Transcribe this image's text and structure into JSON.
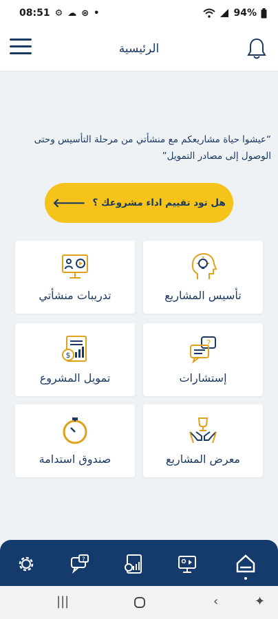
{
  "status_bar": {
    "time": "08:51",
    "battery": "94%"
  },
  "header": {
    "title": "الرئيسية"
  },
  "tagline": "“عيشوا حياة مشاريعكم مع منشأتي من مرحلة التأسيس وحتى الوصول إلى مصادر التمويل”",
  "cta": {
    "label": "هل تود تقييم اداء مشروعك ؟"
  },
  "cards": [
    {
      "label": "تأسيس المشاريع",
      "icon": "head-lightbulb-icon"
    },
    {
      "label": "تدريبات منشأتي",
      "icon": "training-screen-icon"
    },
    {
      "label": "إستشارات",
      "icon": "consultation-chat-icon"
    },
    {
      "label": "تمويل المشروع",
      "icon": "finance-document-icon"
    },
    {
      "label": "معرض المشاريع",
      "icon": "hands-trophy-icon"
    },
    {
      "label": "صندوق استدامة",
      "icon": "stopwatch-icon"
    }
  ],
  "bottom_nav": [
    "settings-gear-icon",
    "chat-help-icon",
    "finance-icon",
    "training-icon",
    "home-icon"
  ],
  "colors": {
    "primary": "#1b3a63",
    "accent": "#f6c31b",
    "nav_bg": "#153b6c",
    "bg": "#eef2f5"
  }
}
